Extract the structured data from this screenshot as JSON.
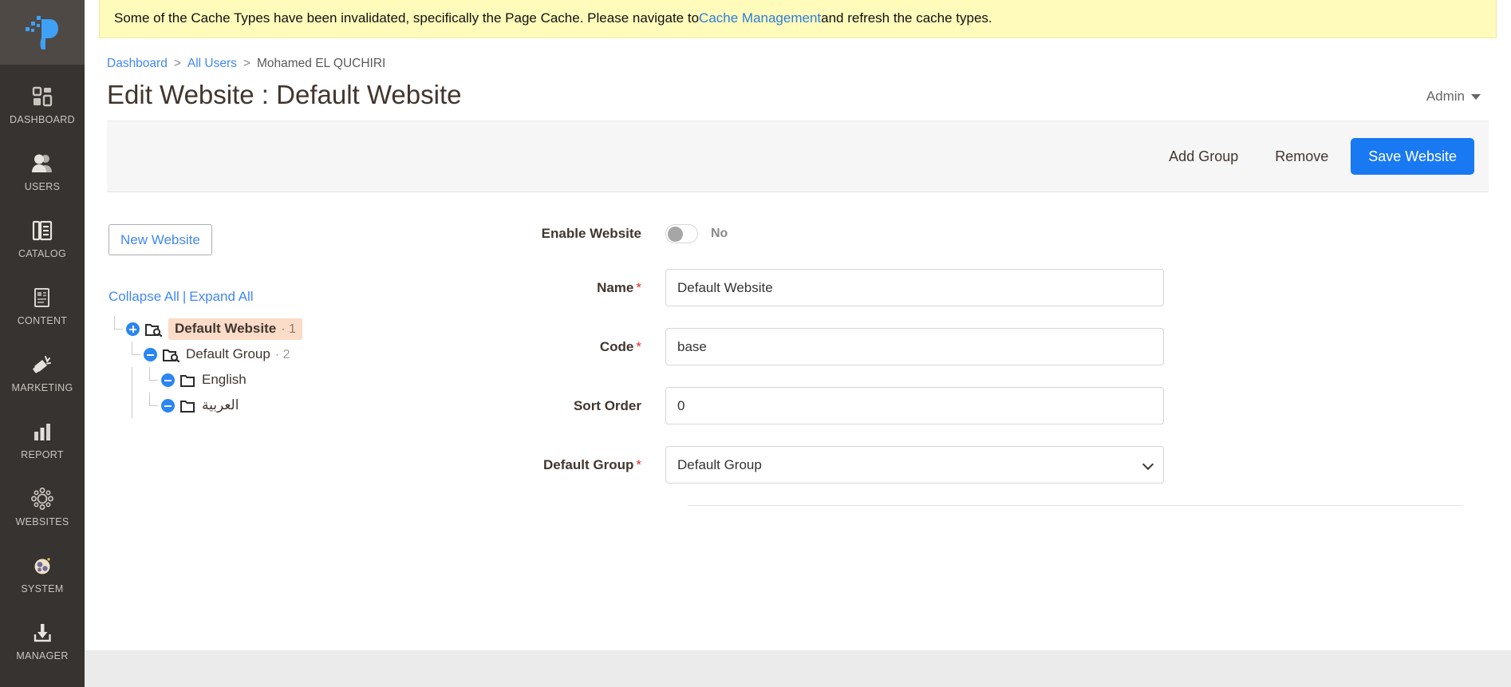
{
  "sidebar": {
    "logo_name": "magento-p-logo",
    "items": [
      {
        "label": "DASHBOARD",
        "icon": "dashboard-grid-icon",
        "name": "sidebar-item-dashboard"
      },
      {
        "label": "USERS",
        "icon": "users-icon",
        "name": "sidebar-item-users"
      },
      {
        "label": "CATALOG",
        "icon": "catalog-book-icon",
        "name": "sidebar-item-catalog"
      },
      {
        "label": "CONTENT",
        "icon": "content-page-icon",
        "name": "sidebar-item-content"
      },
      {
        "label": "MARKETING",
        "icon": "marketing-megaphone-icon",
        "name": "sidebar-item-marketing"
      },
      {
        "label": "REPORT",
        "icon": "report-bars-icon",
        "name": "sidebar-item-report"
      },
      {
        "label": "WEBSITES",
        "icon": "websites-globe-icon",
        "name": "sidebar-item-websites"
      },
      {
        "label": "SYSTEM",
        "icon": "system-gears-icon",
        "name": "sidebar-item-system"
      },
      {
        "label": "MANAGER",
        "icon": "manager-download-icon",
        "name": "sidebar-item-manager"
      }
    ]
  },
  "notice": {
    "text_before": "Some of the Cache Types have been invalidated, specifically the Page Cache. Please navigate to ",
    "link_label": "Cache Management",
    "text_after": " and refresh the cache types."
  },
  "breadcrumb": {
    "items": [
      {
        "label": "Dashboard",
        "link": true
      },
      {
        "label": "All Users",
        "link": true
      },
      {
        "label": "Mohamed EL QUCHIRI",
        "link": false
      }
    ],
    "separator": ">"
  },
  "header": {
    "title": "Edit Website : Default Website",
    "admin_label": "Admin"
  },
  "toolbar": {
    "add_group_label": "Add Group",
    "remove_label": "Remove",
    "save_label": "Save Website"
  },
  "tree_panel": {
    "new_website_label": "New Website",
    "collapse_all_label": "Collapse All",
    "expand_all_label": "Expand All",
    "separator": "|",
    "nodes": [
      {
        "label": "Default Website",
        "count": "1",
        "selected": true,
        "toggle": "plus",
        "icon": "website-search-folder-icon",
        "depth": 0
      },
      {
        "label": "Default Group",
        "count": "2",
        "selected": false,
        "toggle": "minus",
        "icon": "group-search-folder-icon",
        "depth": 1
      },
      {
        "label": "English",
        "count": "",
        "selected": false,
        "toggle": "minus",
        "icon": "store-folder-icon",
        "depth": 2
      },
      {
        "label": "العربية",
        "count": "",
        "selected": false,
        "toggle": "minus",
        "icon": "store-folder-icon",
        "depth": 2,
        "rtl": true
      }
    ],
    "count_separator": "·"
  },
  "form": {
    "enable_website": {
      "label": "Enable Website",
      "value_label": "No",
      "checked": false
    },
    "name": {
      "label": "Name",
      "required": "*",
      "value": "Default Website",
      "placeholder": ""
    },
    "code": {
      "label": "Code",
      "required": "*",
      "value": "base",
      "placeholder": ""
    },
    "sort_order": {
      "label": "Sort Order",
      "required": "",
      "value": "0",
      "placeholder": ""
    },
    "default_group": {
      "label": "Default Group",
      "required": "*",
      "value": "Default Group",
      "options": [
        "Default Group"
      ]
    }
  },
  "colors": {
    "accent_blue": "#1979f2",
    "link_blue": "#4287f5",
    "sidebar_bg": "#373330",
    "notice_bg": "#fffbbb",
    "selected_node_bg": "#fbdcc8",
    "required_red": "#e02b27"
  }
}
